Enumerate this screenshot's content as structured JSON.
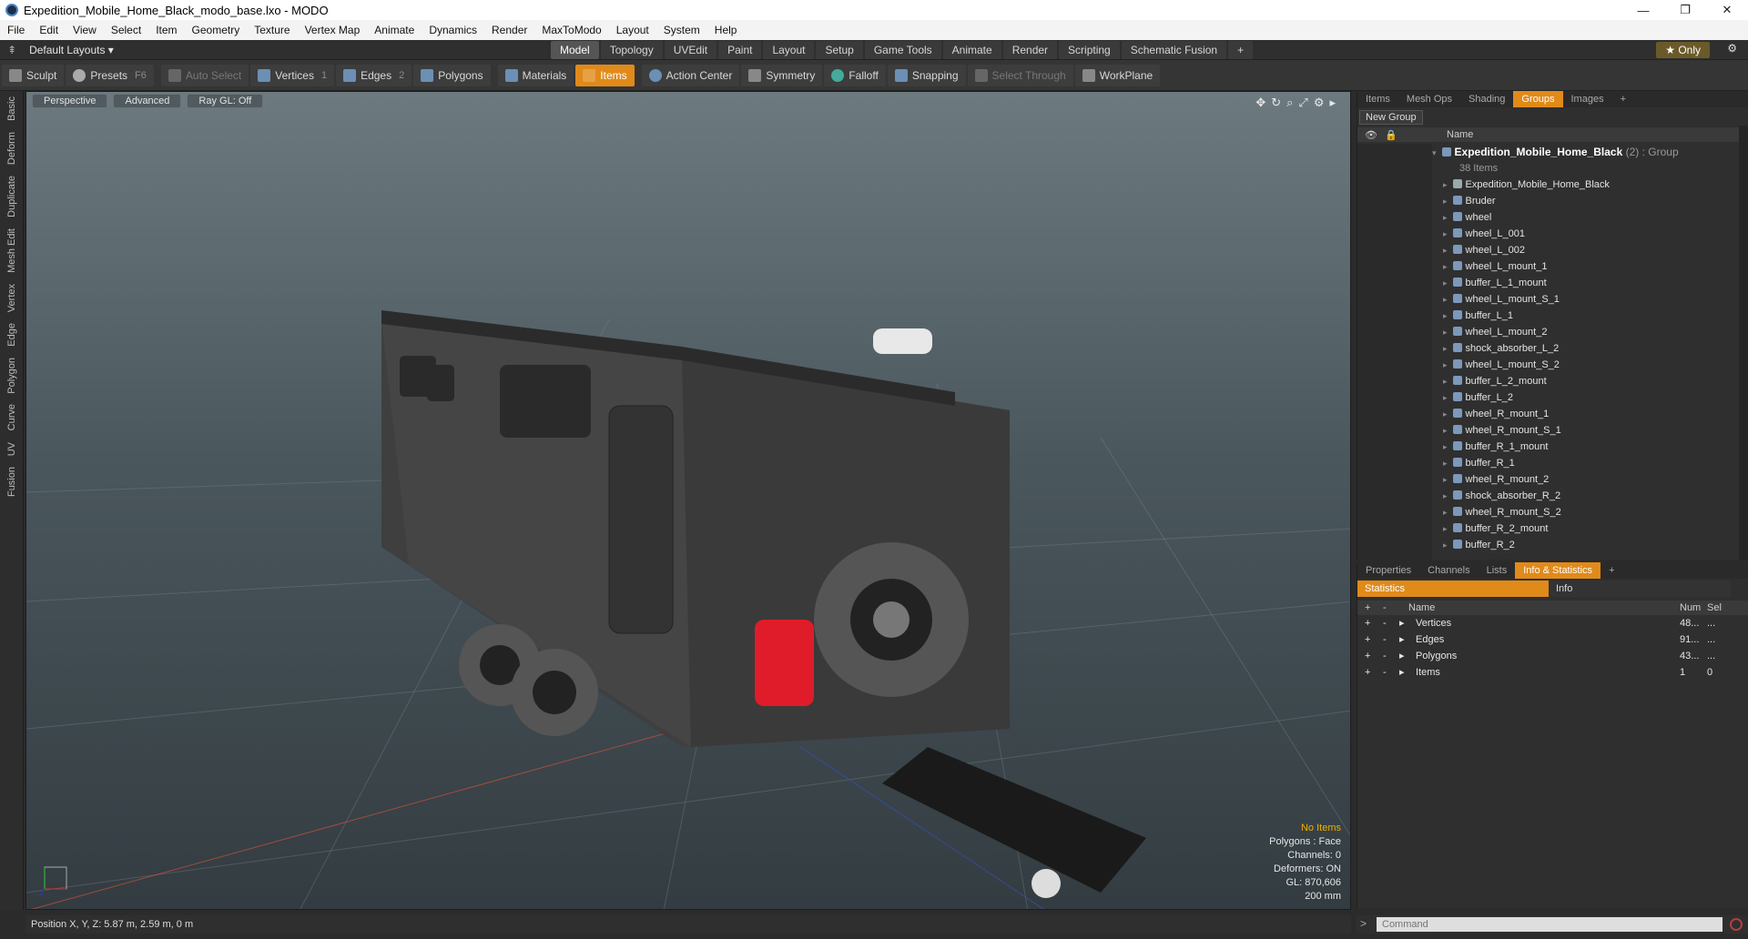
{
  "window": {
    "title": "Expedition_Mobile_Home_Black_modo_base.lxo - MODO",
    "min": "—",
    "max": "❐",
    "close": "✕"
  },
  "menu": [
    "File",
    "Edit",
    "View",
    "Select",
    "Item",
    "Geometry",
    "Texture",
    "Vertex Map",
    "Animate",
    "Dynamics",
    "Render",
    "MaxToModo",
    "Layout",
    "System",
    "Help"
  ],
  "layoutbar": {
    "layout_menu": "Default Layouts ▾",
    "tabs": [
      "Model",
      "Topology",
      "UVEdit",
      "Paint",
      "Layout",
      "Setup",
      "Game Tools",
      "Animate",
      "Render",
      "Scripting",
      "Schematic Fusion",
      "+"
    ],
    "active_tab": "Model",
    "only": "★ Only"
  },
  "toolbar": {
    "sculpt": "Sculpt",
    "presets": "Presets",
    "presets_key": "F6",
    "auto_select": "Auto Select",
    "vertices": "Vertices",
    "vertices_key": "1",
    "edges": "Edges",
    "edges_key": "2",
    "polygons": "Polygons",
    "materials": "Materials",
    "items": "Items",
    "action_center": "Action Center",
    "symmetry": "Symmetry",
    "falloff": "Falloff",
    "snapping": "Snapping",
    "select_through": "Select Through",
    "workplane": "WorkPlane"
  },
  "leftstrip": [
    "Basic",
    "Deform",
    "Duplicate",
    "Mesh Edit",
    "Vertex",
    "Edge",
    "Polygon",
    "Curve",
    "UV",
    "Fusion"
  ],
  "viewport": {
    "view": "Perspective",
    "advanced": "Advanced",
    "raygl": "Ray GL: Off",
    "info": {
      "no_items": "No Items",
      "polygons": "Polygons : Face",
      "channels": "Channels: 0",
      "deformers": "Deformers: ON",
      "gl": "GL: 870,606",
      "scale": "200 mm"
    }
  },
  "status": {
    "position": "Position X, Y, Z:   5.87 m, 2.59 m, 0 m"
  },
  "items_panel": {
    "tabs": [
      "Items",
      "Mesh Ops",
      "Shading",
      "Groups",
      "Images",
      "+"
    ],
    "active_tab": "Groups",
    "new_group": "New Group",
    "name_col": "Name",
    "group_name": "Expedition_Mobile_Home_Black",
    "group_tag": "(2) : Group",
    "group_count": "38 Items",
    "items": [
      "Expedition_Mobile_Home_Black",
      "Bruder",
      "wheel",
      "wheel_L_001",
      "wheel_L_002",
      "wheel_L_mount_1",
      "buffer_L_1_mount",
      "wheel_L_mount_S_1",
      "buffer_L_1",
      "wheel_L_mount_2",
      "shock_absorber_L_2",
      "wheel_L_mount_S_2",
      "buffer_L_2_mount",
      "buffer_L_2",
      "wheel_R_mount_1",
      "wheel_R_mount_S_1",
      "buffer_R_1_mount",
      "buffer_R_1",
      "wheel_R_mount_2",
      "shock_absorber_R_2",
      "wheel_R_mount_S_2",
      "buffer_R_2_mount",
      "buffer_R_2"
    ]
  },
  "stats_panel": {
    "tabs": [
      "Properties",
      "Channels",
      "Lists",
      "Info & Statistics",
      "+"
    ],
    "active_tab": "Info & Statistics",
    "statistics": "Statistics",
    "info": "Info",
    "cols": {
      "name": "Name",
      "num": "Num",
      "sel": "Sel"
    },
    "rows": [
      {
        "name": "Vertices",
        "num": "48...",
        "sel": "..."
      },
      {
        "name": "Edges",
        "num": "91...",
        "sel": "..."
      },
      {
        "name": "Polygons",
        "num": "43...",
        "sel": "..."
      },
      {
        "name": "Items",
        "num": "1",
        "sel": "0"
      }
    ]
  },
  "command": {
    "placeholder": "Command"
  },
  "colors": {
    "accent": "#e08a1a",
    "warn": "#f0b000"
  }
}
